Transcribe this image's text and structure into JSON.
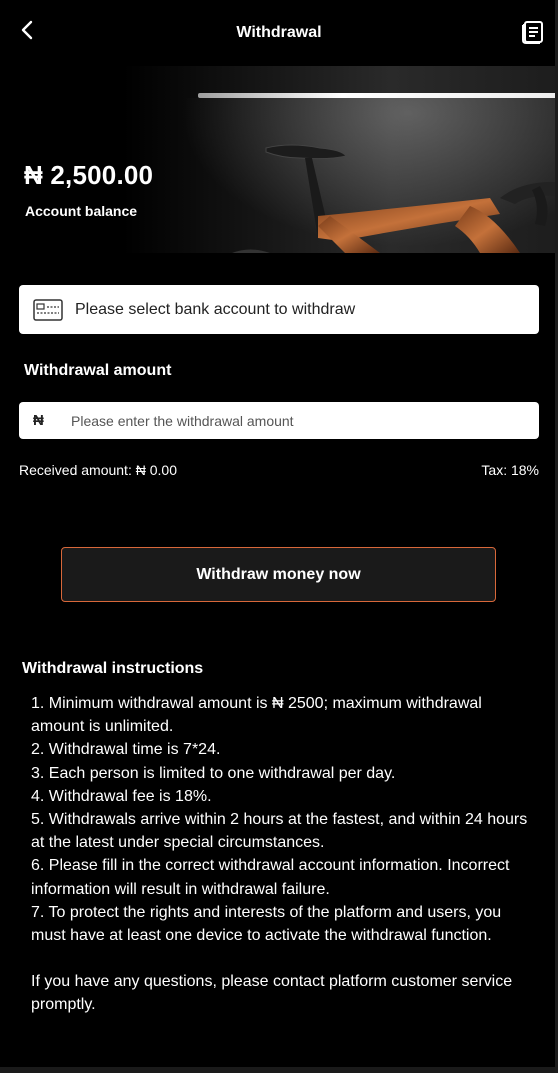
{
  "header": {
    "title": "Withdrawal",
    "back_icon": "chevron-left-icon",
    "record_icon": "document-list-icon"
  },
  "balance": {
    "amount": "₦ 2,500.00",
    "label": "Account balance"
  },
  "bank": {
    "placeholder": "Please select bank account to withdraw",
    "icon": "card-icon"
  },
  "amount": {
    "label": "Withdrawal amount",
    "currency_symbol": "₦",
    "placeholder": "Please enter the withdrawal amount",
    "value": ""
  },
  "summary": {
    "received": "Received amount: ₦ 0.00",
    "tax": "Tax: 18%"
  },
  "action": {
    "withdraw_label": "Withdraw money now"
  },
  "instructions": {
    "title": "Withdrawal instructions",
    "items": [
      "1. Minimum withdrawal amount is ₦ 2500; maximum withdrawal amount is unlimited.",
      "2. Withdrawal time is 7*24.",
      "3. Each person is limited to one withdrawal per day.",
      "4. Withdrawal fee is 18%.",
      "5. Withdrawals arrive within 2 hours at the fastest, and within 24 hours at the latest under special circumstances.",
      "6. Please fill in the correct withdrawal account information. Incorrect information will result in withdrawal failure.",
      "7. To protect the rights and interests of the platform and users, you must have at least one device to activate the withdrawal function."
    ],
    "contact": "If you have any questions, please contact platform customer service promptly."
  },
  "colors": {
    "background": "#000000",
    "button_border": "#d8683a",
    "field_background": "#ffffff"
  }
}
